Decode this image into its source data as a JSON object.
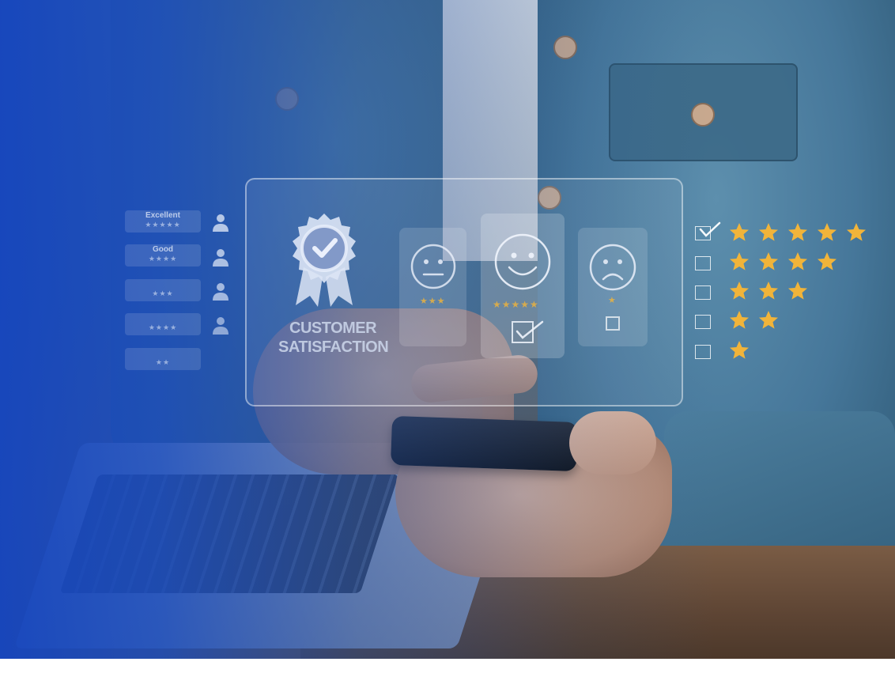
{
  "hud": {
    "caption_line1": "CUSTOMER",
    "caption_line2": "SATISFACTION",
    "faces": [
      {
        "name": "neutral",
        "stars": 3
      },
      {
        "name": "happy",
        "stars": 5,
        "checked": true
      },
      {
        "name": "sad",
        "stars": 1,
        "checked": false
      }
    ]
  },
  "rating_list": [
    {
      "label": "Excellent",
      "stars": "★★★★★"
    },
    {
      "label": "Good",
      "stars": "★★★★"
    },
    {
      "label": "",
      "stars": "★★★"
    },
    {
      "label": "",
      "stars": "★★★★"
    },
    {
      "label": "",
      "stars": "★★"
    }
  ],
  "star_ratings": [
    {
      "stars": 5,
      "checked": true
    },
    {
      "stars": 4,
      "checked": false
    },
    {
      "stars": 3,
      "checked": false
    },
    {
      "stars": 2,
      "checked": false
    },
    {
      "stars": 1,
      "checked": false
    }
  ],
  "colors": {
    "overlay_blue": "#1f4fc0",
    "star_gold": "#f1b43a",
    "hud_line": "#ffffff"
  },
  "icons": [
    "award-badge-icon",
    "neutral-face-icon",
    "smiley-face-icon",
    "sad-face-icon",
    "user-icon",
    "star-icon",
    "checkbox-icon",
    "checkmark-icon"
  ]
}
